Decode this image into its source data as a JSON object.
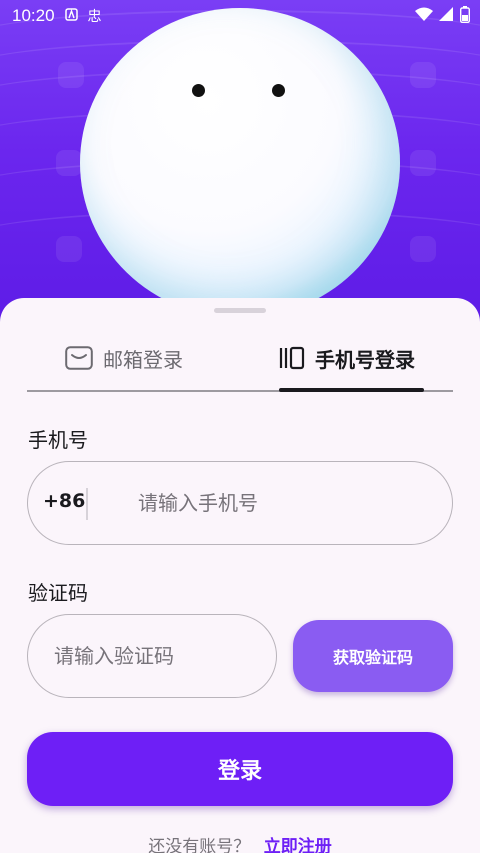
{
  "status_bar": {
    "time": "10:20",
    "notification_icons": [
      "a-icon",
      "chinese-char-icon"
    ],
    "notification_char": "忠",
    "right_icons": [
      "wifi-icon",
      "signal-icon",
      "battery-icon"
    ]
  },
  "tabs": {
    "email": {
      "label": "邮箱登录",
      "icon": "mail-icon"
    },
    "phone": {
      "label": "手机号登录",
      "icon": "phone-icon",
      "active": true
    }
  },
  "form": {
    "phone_label": "手机号",
    "country_code": "+86",
    "phone_placeholder": "请输入手机号",
    "phone_value": "",
    "code_label": "验证码",
    "code_placeholder": "请输入验证码",
    "code_value": "",
    "get_code_label": "获取验证码",
    "login_label": "登录"
  },
  "footer": {
    "question": "还没有账号？",
    "register_link": "立即注册"
  },
  "colors": {
    "hero": "#6b26ee",
    "accent": "#6e1ff6",
    "secondary_button": "#8a5cf2",
    "sheet": "#fbf5fb"
  }
}
